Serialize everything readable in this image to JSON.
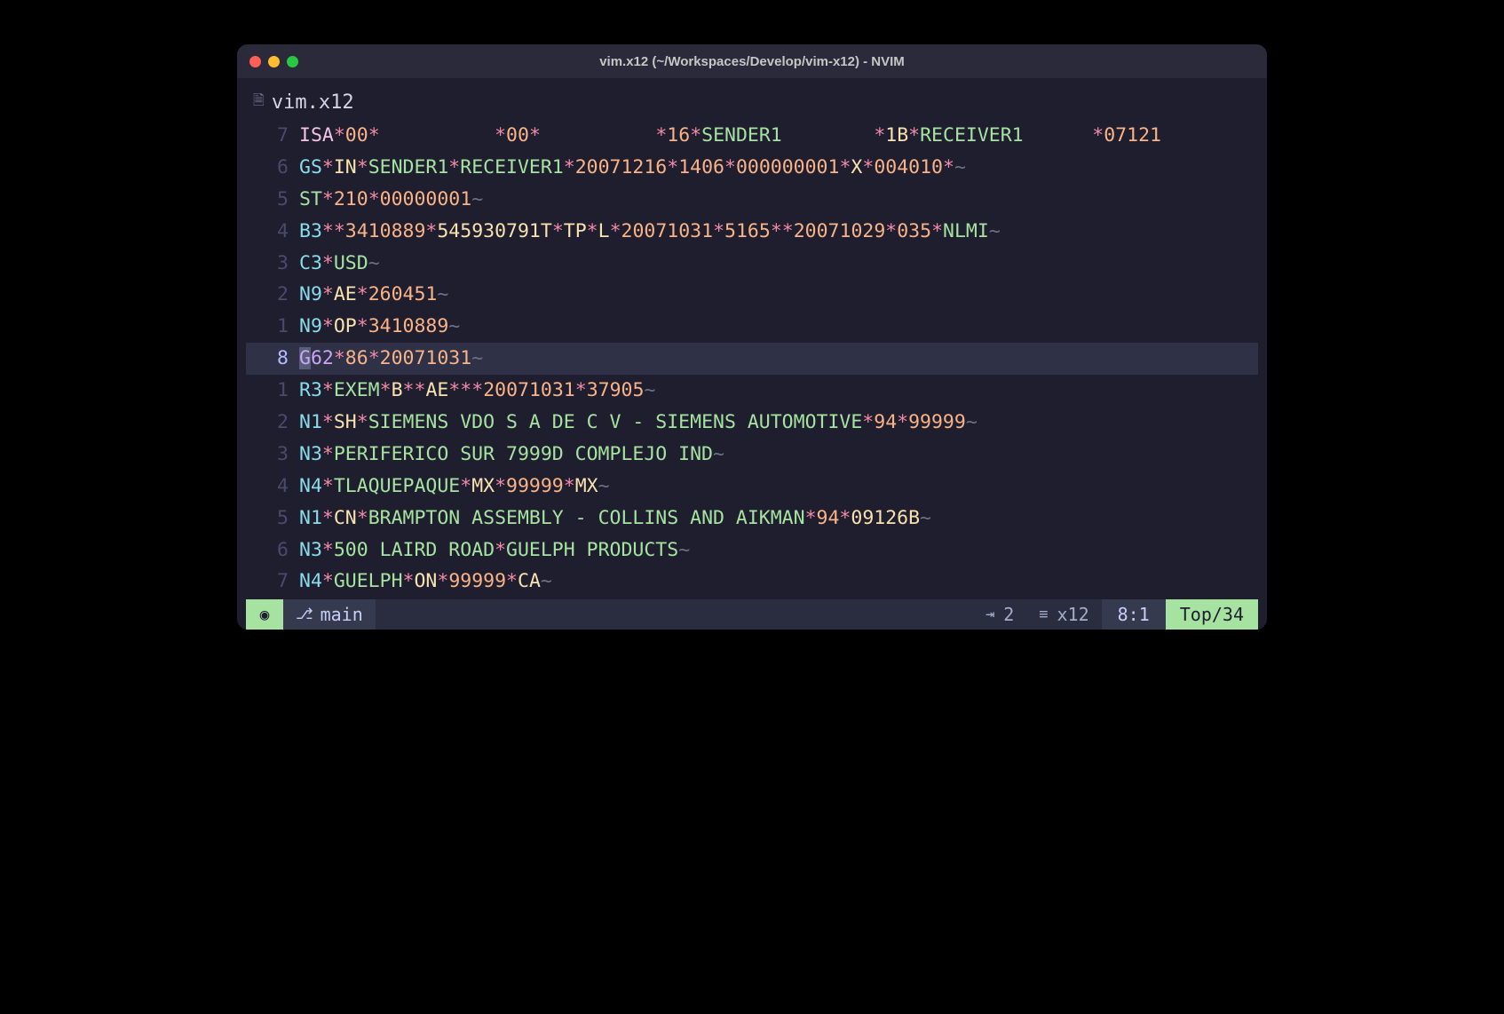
{
  "window": {
    "title": "vim.x12 (~/Workspaces/Develop/vim-x12) - NVIM"
  },
  "tab": {
    "filename": "vim.x12"
  },
  "editor": {
    "current_line_abs": "8",
    "lines": [
      {
        "rel": "7",
        "tokens": [
          {
            "t": "ISA",
            "c": "tk-isa"
          },
          {
            "t": "*",
            "c": "tk-delim"
          },
          {
            "t": "00",
            "c": "tk-num"
          },
          {
            "t": "*",
            "c": "tk-delim"
          },
          {
            "t": "          ",
            "c": "tk-plain"
          },
          {
            "t": "*",
            "c": "tk-delim"
          },
          {
            "t": "00",
            "c": "tk-num"
          },
          {
            "t": "*",
            "c": "tk-delim"
          },
          {
            "t": "          ",
            "c": "tk-plain"
          },
          {
            "t": "*",
            "c": "tk-delim"
          },
          {
            "t": "16",
            "c": "tk-num"
          },
          {
            "t": "*",
            "c": "tk-delim"
          },
          {
            "t": "SENDER1        ",
            "c": "tk-str"
          },
          {
            "t": "*",
            "c": "tk-delim"
          },
          {
            "t": "1B",
            "c": "tk-code"
          },
          {
            "t": "*",
            "c": "tk-delim"
          },
          {
            "t": "RECEIVER1      ",
            "c": "tk-str"
          },
          {
            "t": "*",
            "c": "tk-delim"
          },
          {
            "t": "07121",
            "c": "tk-num"
          }
        ]
      },
      {
        "rel": "6",
        "tokens": [
          {
            "t": "GS",
            "c": "tk-seg"
          },
          {
            "t": "*",
            "c": "tk-delim"
          },
          {
            "t": "IN",
            "c": "tk-code"
          },
          {
            "t": "*",
            "c": "tk-delim"
          },
          {
            "t": "SENDER1",
            "c": "tk-str"
          },
          {
            "t": "*",
            "c": "tk-delim"
          },
          {
            "t": "RECEIVER1",
            "c": "tk-str"
          },
          {
            "t": "*",
            "c": "tk-delim"
          },
          {
            "t": "20071216",
            "c": "tk-num"
          },
          {
            "t": "*",
            "c": "tk-delim"
          },
          {
            "t": "1406",
            "c": "tk-num"
          },
          {
            "t": "*",
            "c": "tk-delim"
          },
          {
            "t": "000000001",
            "c": "tk-num"
          },
          {
            "t": "*",
            "c": "tk-delim"
          },
          {
            "t": "X",
            "c": "tk-code"
          },
          {
            "t": "*",
            "c": "tk-delim"
          },
          {
            "t": "004010",
            "c": "tk-num"
          },
          {
            "t": "*",
            "c": "tk-delim"
          },
          {
            "t": "~",
            "c": "tk-term"
          }
        ]
      },
      {
        "rel": "5",
        "tokens": [
          {
            "t": "ST",
            "c": "tk-st"
          },
          {
            "t": "*",
            "c": "tk-delim"
          },
          {
            "t": "210",
            "c": "tk-num"
          },
          {
            "t": "*",
            "c": "tk-delim"
          },
          {
            "t": "00000001",
            "c": "tk-num"
          },
          {
            "t": "~",
            "c": "tk-term"
          }
        ]
      },
      {
        "rel": "4",
        "tokens": [
          {
            "t": "B3",
            "c": "tk-seg"
          },
          {
            "t": "*",
            "c": "tk-delim"
          },
          {
            "t": "*",
            "c": "tk-delim"
          },
          {
            "t": "3410889",
            "c": "tk-num"
          },
          {
            "t": "*",
            "c": "tk-delim"
          },
          {
            "t": "545930791T",
            "c": "tk-code"
          },
          {
            "t": "*",
            "c": "tk-delim"
          },
          {
            "t": "TP",
            "c": "tk-code"
          },
          {
            "t": "*",
            "c": "tk-delim"
          },
          {
            "t": "L",
            "c": "tk-code"
          },
          {
            "t": "*",
            "c": "tk-delim"
          },
          {
            "t": "20071031",
            "c": "tk-num"
          },
          {
            "t": "*",
            "c": "tk-delim"
          },
          {
            "t": "5165",
            "c": "tk-num"
          },
          {
            "t": "*",
            "c": "tk-delim"
          },
          {
            "t": "*",
            "c": "tk-delim"
          },
          {
            "t": "20071029",
            "c": "tk-num"
          },
          {
            "t": "*",
            "c": "tk-delim"
          },
          {
            "t": "035",
            "c": "tk-num"
          },
          {
            "t": "*",
            "c": "tk-delim"
          },
          {
            "t": "NLMI",
            "c": "tk-str"
          },
          {
            "t": "~",
            "c": "tk-term"
          }
        ]
      },
      {
        "rel": "3",
        "tokens": [
          {
            "t": "C3",
            "c": "tk-seg"
          },
          {
            "t": "*",
            "c": "tk-delim"
          },
          {
            "t": "USD",
            "c": "tk-str"
          },
          {
            "t": "~",
            "c": "tk-term"
          }
        ]
      },
      {
        "rel": "2",
        "tokens": [
          {
            "t": "N9",
            "c": "tk-seg"
          },
          {
            "t": "*",
            "c": "tk-delim"
          },
          {
            "t": "AE",
            "c": "tk-code"
          },
          {
            "t": "*",
            "c": "tk-delim"
          },
          {
            "t": "260451",
            "c": "tk-num"
          },
          {
            "t": "~",
            "c": "tk-term"
          }
        ]
      },
      {
        "rel": "1",
        "tokens": [
          {
            "t": "N9",
            "c": "tk-seg"
          },
          {
            "t": "*",
            "c": "tk-delim"
          },
          {
            "t": "OP",
            "c": "tk-code"
          },
          {
            "t": "*",
            "c": "tk-delim"
          },
          {
            "t": "3410889",
            "c": "tk-num"
          },
          {
            "t": "~",
            "c": "tk-term"
          }
        ]
      },
      {
        "rel": "8",
        "abs": true,
        "current": true,
        "tokens": [
          {
            "t": "G",
            "c": "tk-gseg cursor-hl"
          },
          {
            "t": "62",
            "c": "tk-gseg"
          },
          {
            "t": "*",
            "c": "tk-delim"
          },
          {
            "t": "86",
            "c": "tk-num"
          },
          {
            "t": "*",
            "c": "tk-delim"
          },
          {
            "t": "20071031",
            "c": "tk-num"
          },
          {
            "t": "~",
            "c": "tk-term"
          }
        ]
      },
      {
        "rel": "1",
        "tokens": [
          {
            "t": "R3",
            "c": "tk-seg"
          },
          {
            "t": "*",
            "c": "tk-delim"
          },
          {
            "t": "EXEM",
            "c": "tk-str"
          },
          {
            "t": "*",
            "c": "tk-delim"
          },
          {
            "t": "B",
            "c": "tk-code"
          },
          {
            "t": "*",
            "c": "tk-delim"
          },
          {
            "t": "*",
            "c": "tk-delim"
          },
          {
            "t": "AE",
            "c": "tk-code"
          },
          {
            "t": "*",
            "c": "tk-delim"
          },
          {
            "t": "*",
            "c": "tk-delim"
          },
          {
            "t": "*",
            "c": "tk-delim"
          },
          {
            "t": "20071031",
            "c": "tk-num"
          },
          {
            "t": "*",
            "c": "tk-delim"
          },
          {
            "t": "37905",
            "c": "tk-num"
          },
          {
            "t": "~",
            "c": "tk-term"
          }
        ]
      },
      {
        "rel": "2",
        "tokens": [
          {
            "t": "N1",
            "c": "tk-seg"
          },
          {
            "t": "*",
            "c": "tk-delim"
          },
          {
            "t": "SH",
            "c": "tk-code"
          },
          {
            "t": "*",
            "c": "tk-delim"
          },
          {
            "t": "SIEMENS VDO S A DE C V - SIEMENS AUTOMOTIVE",
            "c": "tk-str"
          },
          {
            "t": "*",
            "c": "tk-delim"
          },
          {
            "t": "94",
            "c": "tk-num"
          },
          {
            "t": "*",
            "c": "tk-delim"
          },
          {
            "t": "99999",
            "c": "tk-num"
          },
          {
            "t": "~",
            "c": "tk-term"
          }
        ]
      },
      {
        "rel": "3",
        "tokens": [
          {
            "t": "N3",
            "c": "tk-seg"
          },
          {
            "t": "*",
            "c": "tk-delim"
          },
          {
            "t": "PERIFERICO SUR 7999D COMPLEJO IND",
            "c": "tk-str"
          },
          {
            "t": "~",
            "c": "tk-term"
          }
        ]
      },
      {
        "rel": "4",
        "tokens": [
          {
            "t": "N4",
            "c": "tk-seg"
          },
          {
            "t": "*",
            "c": "tk-delim"
          },
          {
            "t": "TLAQUEPAQUE",
            "c": "tk-str"
          },
          {
            "t": "*",
            "c": "tk-delim"
          },
          {
            "t": "MX",
            "c": "tk-code"
          },
          {
            "t": "*",
            "c": "tk-delim"
          },
          {
            "t": "99999",
            "c": "tk-num"
          },
          {
            "t": "*",
            "c": "tk-delim"
          },
          {
            "t": "MX",
            "c": "tk-code"
          },
          {
            "t": "~",
            "c": "tk-term"
          }
        ]
      },
      {
        "rel": "5",
        "tokens": [
          {
            "t": "N1",
            "c": "tk-seg"
          },
          {
            "t": "*",
            "c": "tk-delim"
          },
          {
            "t": "CN",
            "c": "tk-code"
          },
          {
            "t": "*",
            "c": "tk-delim"
          },
          {
            "t": "BRAMPTON ASSEMBLY - COLLINS AND AIKMAN",
            "c": "tk-str"
          },
          {
            "t": "*",
            "c": "tk-delim"
          },
          {
            "t": "94",
            "c": "tk-num"
          },
          {
            "t": "*",
            "c": "tk-delim"
          },
          {
            "t": "09126B",
            "c": "tk-code"
          },
          {
            "t": "~",
            "c": "tk-term"
          }
        ]
      },
      {
        "rel": "6",
        "tokens": [
          {
            "t": "N3",
            "c": "tk-seg"
          },
          {
            "t": "*",
            "c": "tk-delim"
          },
          {
            "t": "500 LAIRD ROAD",
            "c": "tk-str"
          },
          {
            "t": "*",
            "c": "tk-delim"
          },
          {
            "t": "GUELPH PRODUCTS",
            "c": "tk-str"
          },
          {
            "t": "~",
            "c": "tk-term"
          }
        ]
      },
      {
        "rel": "7",
        "tokens": [
          {
            "t": "N4",
            "c": "tk-seg"
          },
          {
            "t": "*",
            "c": "tk-delim"
          },
          {
            "t": "GUELPH",
            "c": "tk-str"
          },
          {
            "t": "*",
            "c": "tk-delim"
          },
          {
            "t": "ON",
            "c": "tk-code"
          },
          {
            "t": "*",
            "c": "tk-delim"
          },
          {
            "t": "99999",
            "c": "tk-num"
          },
          {
            "t": "*",
            "c": "tk-delim"
          },
          {
            "t": "CA",
            "c": "tk-code"
          },
          {
            "t": "~",
            "c": "tk-term"
          }
        ]
      }
    ]
  },
  "statusline": {
    "mode_icon": "◉",
    "branch_icon": "⎇",
    "branch": "main",
    "indent_icon": "⇥",
    "indent": "2",
    "lines_icon": "≡",
    "filetype": "x12",
    "position": "8:1",
    "percent": "Top/34"
  }
}
